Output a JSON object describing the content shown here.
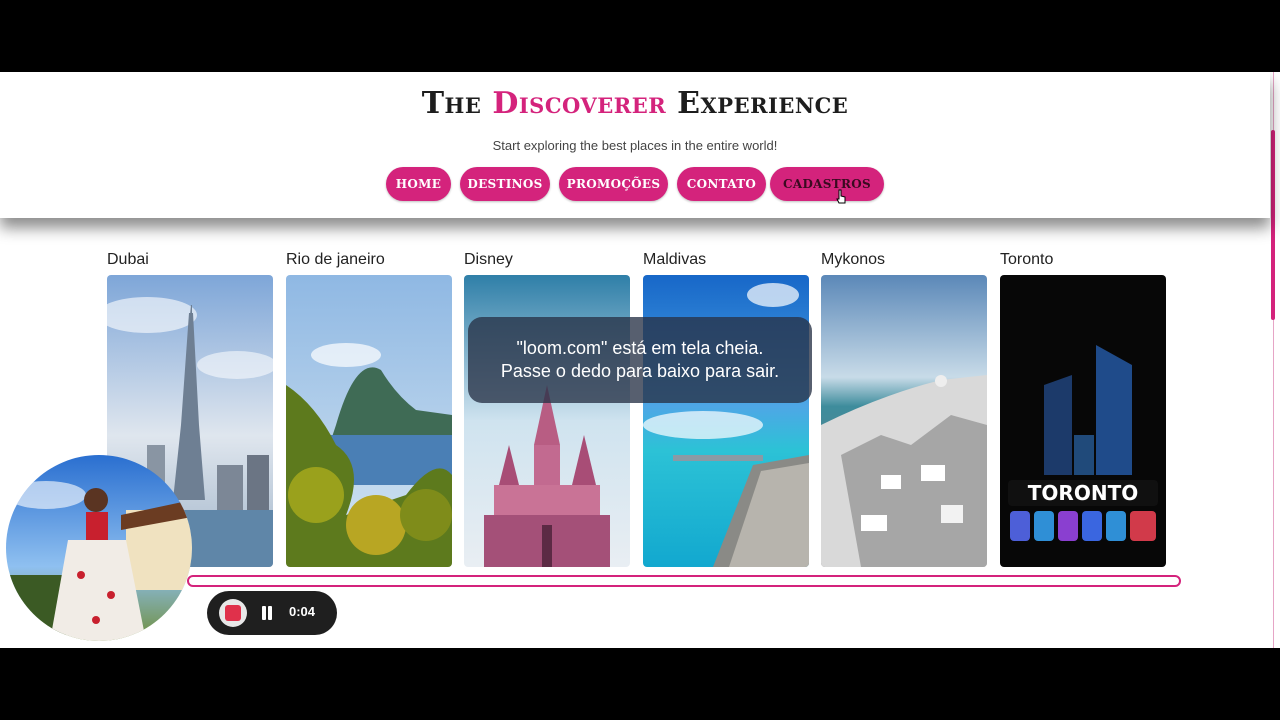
{
  "header": {
    "title_part1": "The ",
    "title_accent": "Discoverer",
    "title_part2": " Experience",
    "subtitle": "Start exploring the best places in the entire world!"
  },
  "nav": {
    "items": [
      {
        "label": "HOME"
      },
      {
        "label": "DESTINOS"
      },
      {
        "label": "PROMOÇÕES"
      },
      {
        "label": "CONTATO"
      },
      {
        "label": "CADASTROS"
      }
    ]
  },
  "destinations": [
    {
      "label": "Dubai"
    },
    {
      "label": "Rio de janeiro"
    },
    {
      "label": "Disney"
    },
    {
      "label": "Maldivas"
    },
    {
      "label": "Mykonos"
    },
    {
      "label": "Toronto",
      "sign_text": "TORONTO"
    }
  ],
  "toast": {
    "line1": "\"loom.com\" está em tela cheia.",
    "line2": "Passe o dedo para baixo para sair."
  },
  "recorder": {
    "time": "0:04"
  },
  "colors": {
    "accent": "#d4237c",
    "background": "#ffffff"
  }
}
